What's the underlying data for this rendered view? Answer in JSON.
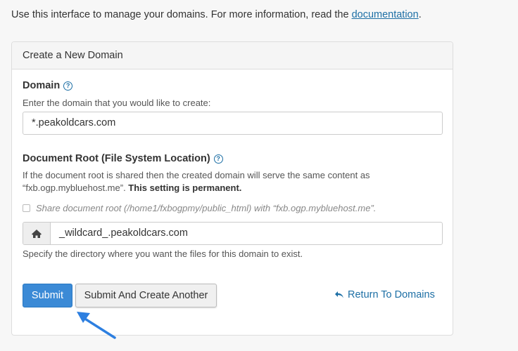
{
  "intro": {
    "text": "Use this interface to manage your domains. For more information, read the ",
    "link_label": "documentation",
    "suffix": "."
  },
  "panel": {
    "heading": "Create a New Domain",
    "domain": {
      "label": "Domain",
      "hint": "Enter the domain that you would like to create:",
      "value": "*.peakoldcars.com"
    },
    "docroot": {
      "label": "Document Root (File System Location)",
      "desc_text": "If the document root is shared then the created domain will serve the same content as “fxb.ogp.mybluehost.me”. ",
      "desc_bold": "This setting is permanent.",
      "share_checkbox_label": "Share document root (/home1/fxbogpmy/public_html) with “fxb.ogp.mybluehost.me”.",
      "share_checked": false,
      "value": "_wildcard_.peakoldcars.com",
      "hint": "Specify the directory where you want the files for this domain to exist."
    }
  },
  "actions": {
    "submit_label": "Submit",
    "submit_another_label": "Submit And Create Another",
    "return_label": "Return To Domains"
  },
  "icons": {
    "help": "help-circle-icon",
    "home": "home-icon",
    "return": "return-arrow-icon",
    "annotation_arrow": "pointer-arrow-icon"
  },
  "colors": {
    "primary": "#3b8ad6",
    "link": "#1d6fa5",
    "annotation": "#2d7fe0"
  }
}
